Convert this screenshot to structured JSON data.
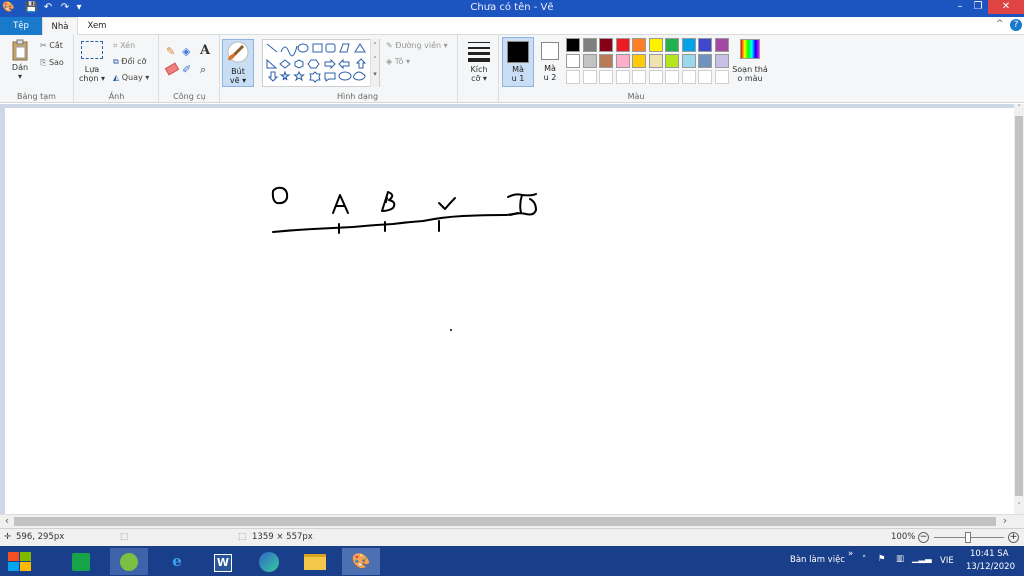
{
  "window": {
    "title": "Chưa có tên - Vẽ",
    "minimize": "–",
    "restore": "❐",
    "close": "✕"
  },
  "quick_access": {
    "save": "💾",
    "undo": "↶",
    "redo": "↷",
    "customize": "▾"
  },
  "tabs": {
    "file": "Tệp",
    "home": "Nhà",
    "view": "Xem"
  },
  "help": {
    "collapse": "^",
    "help": "?"
  },
  "ribbon": {
    "clipboard": {
      "paste": "Dán",
      "paste_arrow": "▾",
      "cut": "Cắt",
      "copy": "Sao",
      "group": "Bảng tạm"
    },
    "image": {
      "select": "Lựa",
      "select2": "chọn ▾",
      "crop": "Xén",
      "resize": "Đổi cỡ",
      "rotate": "Quay ▾",
      "group": "Ảnh"
    },
    "tools": {
      "text_glyph": "A",
      "group": "Công cụ"
    },
    "brushes": {
      "label1": "Bút",
      "label2": "vẽ ▾"
    },
    "shapes": {
      "outline": "Đường viền ▾",
      "fill": "Tô ▾",
      "group": "Hình dạng"
    },
    "size": {
      "label1": "Kích",
      "label2": "cỡ ▾"
    },
    "colors": {
      "color1_1": "Mà",
      "color1_2": "u 1",
      "color2_1": "Mà",
      "color2_2": "u 2",
      "edit1": "Soạn thả",
      "edit2": "o màu",
      "group": "Màu",
      "color1_value": "#000000",
      "color2_value": "#ffffff",
      "palette_row1": [
        "#000000",
        "#7f7f7f",
        "#880015",
        "#ed1c24",
        "#ff7f27",
        "#fff200",
        "#22b14c",
        "#00a2e8",
        "#3f48cc",
        "#a349a4"
      ],
      "palette_row2": [
        "#ffffff",
        "#c3c3c3",
        "#b97a57",
        "#ffaec9",
        "#ffc90e",
        "#efe4b0",
        "#b5e61d",
        "#99d9ea",
        "#7092be",
        "#c8bfe7"
      ],
      "palette_row3": [
        "#ffffff",
        "#ffffff",
        "#ffffff",
        "#ffffff",
        "#ffffff",
        "#ffffff",
        "#ffffff",
        "#ffffff",
        "#ffffff",
        "#ffffff"
      ]
    }
  },
  "status": {
    "cursor_pos": "596, 295px",
    "canvas_size": "1359 × 557px",
    "zoom": "100%",
    "zoom_out": "−",
    "zoom_in": "+"
  },
  "scroll": {
    "left": "‹",
    "right": "›",
    "up": "˄",
    "down": "˅"
  },
  "taskbar": {
    "desktop_label": "Bàn làm việc",
    "chevron": "»",
    "language": "VIE",
    "time": "10:41 SA",
    "date": "13/12/2020"
  }
}
